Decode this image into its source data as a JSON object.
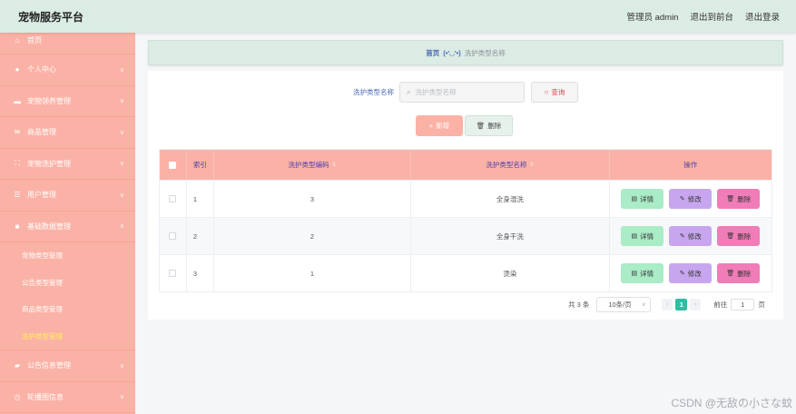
{
  "header": {
    "title": "宠物服务平台",
    "user_label": "管理员 admin",
    "back_front": "退出到前台",
    "logout": "退出登录"
  },
  "sidebar": {
    "items": [
      {
        "label": "首页",
        "icon": "home-icon"
      },
      {
        "label": "个人中心",
        "icon": "user-icon"
      },
      {
        "label": "宠物领养管理",
        "icon": "briefcase-icon"
      },
      {
        "label": "商品管理",
        "icon": "mail-icon"
      },
      {
        "label": "宠物洗护管理",
        "icon": "frame-icon"
      },
      {
        "label": "用户管理",
        "icon": "sliders-icon"
      },
      {
        "label": "基础数据管理",
        "icon": "box-icon"
      }
    ],
    "submenu": [
      {
        "label": "宠物类型管理"
      },
      {
        "label": "公告类型管理"
      },
      {
        "label": "商品类型管理"
      },
      {
        "label": "洗护类型管理"
      }
    ],
    "bottom_items": [
      {
        "label": "公告信息管理",
        "icon": "ticket-icon"
      },
      {
        "label": "轮播图信息",
        "icon": "clock-icon"
      }
    ]
  },
  "breadcrumb": {
    "home": "首页",
    "face": "(•'◡'•)",
    "current": "洗护类型名称"
  },
  "search": {
    "label": "洗护类型名称",
    "placeholder": "洗护类型名称",
    "button": "查询"
  },
  "actions": {
    "add": "新增",
    "delete": "删除"
  },
  "table": {
    "headers": {
      "index": "索引",
      "code": "洗护类型编码",
      "name": "洗护类型名称",
      "ops": "操作"
    },
    "rows": [
      {
        "index": "1",
        "code": "3",
        "name": "全身湿洗"
      },
      {
        "index": "2",
        "code": "2",
        "name": "全身干洗"
      },
      {
        "index": "3",
        "code": "1",
        "name": "烫染"
      }
    ],
    "op_labels": {
      "detail": "详情",
      "edit": "修改",
      "delete": "删除"
    }
  },
  "pagination": {
    "total": "共 3 条",
    "page_size": "10条/页",
    "current_page": "1",
    "goto_label": "前往",
    "goto_value": "1",
    "page_suffix": "页"
  },
  "watermark": "CSDN @无敌の小さな蚊",
  "colors": {
    "header_bg": "#dbece4",
    "sidebar_bg": "#fbb2a6",
    "active_submenu": "#ffef5b",
    "detail_btn": "#a9ecc6",
    "edit_btn": "#c8a6ef",
    "delete_btn": "#f07cb8",
    "pager_active": "#2bbfa4"
  }
}
